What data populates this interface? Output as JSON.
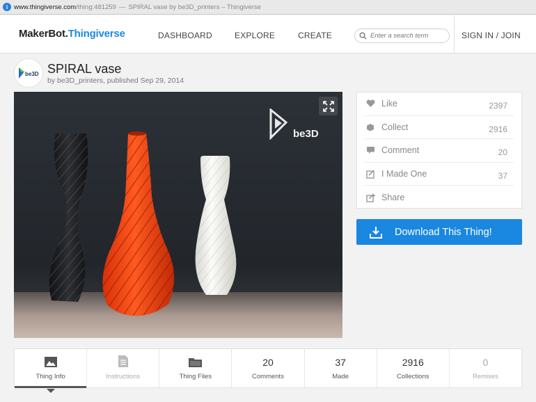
{
  "browser": {
    "url_domain": "www.thingiverse.com",
    "url_path": "/thing:481259",
    "page_title": "SPIRAL vase by be3D_printers – Thingiverse",
    "title_separator": "—"
  },
  "header": {
    "logo_makerbot": "MakerBot.",
    "logo_thingiverse": "Thingiverse",
    "nav": [
      "DASHBOARD",
      "EXPLORE",
      "CREATE"
    ],
    "search_placeholder": "Enter a search term",
    "signin": "SIGN IN / JOIN"
  },
  "thing": {
    "title": "SPIRAL vase",
    "byline": "by be3D_printers, published Sep 29, 2014",
    "avatar_text": "be3D",
    "watermark_text": "be3D"
  },
  "actions": [
    {
      "label": "Like",
      "count": "2397",
      "icon": "heart-icon"
    },
    {
      "label": "Collect",
      "count": "2916",
      "icon": "collect-icon"
    },
    {
      "label": "Comment",
      "count": "20",
      "icon": "comment-icon"
    },
    {
      "label": "I Made One",
      "count": "37",
      "icon": "made-one-icon"
    },
    {
      "label": "Share",
      "count": "",
      "icon": "share-icon"
    }
  ],
  "download_label": "Download This Thing!",
  "tabs": [
    {
      "label": "Thing Info",
      "top": "",
      "icon": "thing-info-icon",
      "active": true
    },
    {
      "label": "Instructions",
      "top": "",
      "icon": "instructions-icon",
      "muted": true
    },
    {
      "label": "Thing Files",
      "top": "",
      "icon": "thing-files-icon"
    },
    {
      "label": "Comments",
      "top": "20"
    },
    {
      "label": "Made",
      "top": "37"
    },
    {
      "label": "Collections",
      "top": "2916"
    },
    {
      "label": "Remixes",
      "top": "0",
      "muted": true
    }
  ],
  "colors": {
    "accent": "#1a87e0",
    "vase_orange": "#ff4a14",
    "vase_black": "#1c1d20",
    "vase_white": "#f2f2ee"
  }
}
